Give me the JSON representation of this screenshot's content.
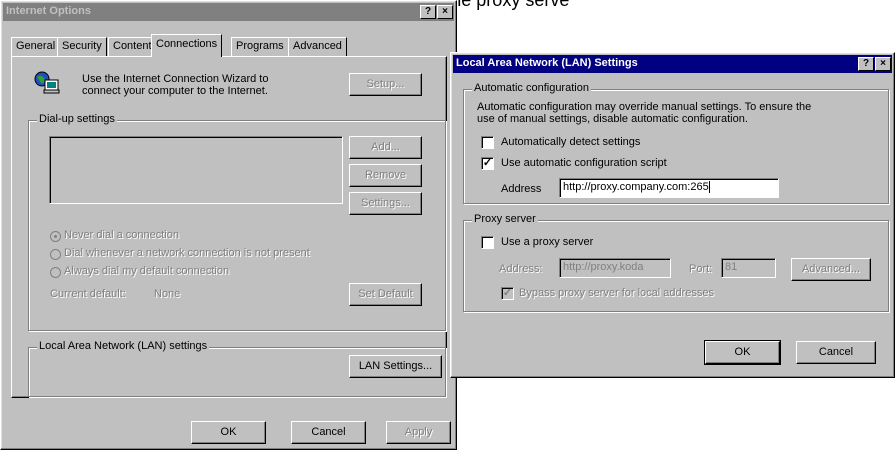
{
  "background": {
    "text": "able to an xxx Add appear in the information about the proxy serve"
  },
  "internet_options": {
    "title": "Internet Options",
    "help_button": "?",
    "close_button": "×",
    "tabs": [
      "General",
      "Security",
      "Content",
      "Connections",
      "Programs",
      "Advanced"
    ],
    "active_tab": "Connections",
    "wizard_text_line1": "Use the Internet Connection Wizard to",
    "wizard_text_line2": "connect your computer to the Internet.",
    "setup_button": "Setup...",
    "dialup_group": "Dial-up settings",
    "add_button": "Add...",
    "remove_button": "Remove",
    "settings_button": "Settings...",
    "radio_never": "Never dial a connection",
    "radio_whenever": "Dial whenever a network connection is not present",
    "radio_always": "Always dial my default connection",
    "current_default_label": "Current default:",
    "current_default_value": "None",
    "set_default_button": "Set Default",
    "lan_group": "Local Area Network (LAN) settings",
    "lan_settings_button": "LAN Settings...",
    "ok_button": "OK",
    "cancel_button": "Cancel",
    "apply_button": "Apply"
  },
  "lan_dialog": {
    "title": "Local Area Network (LAN) Settings",
    "help_button": "?",
    "close_button": "×",
    "auto_config_group": "Automatic configuration",
    "auto_config_desc_line1": "Automatic configuration may override manual settings.  To ensure the",
    "auto_config_desc_line2": "use of manual settings, disable automatic configuration.",
    "auto_detect_label": "Automatically detect settings",
    "auto_detect_checked": false,
    "use_script_label": "Use automatic configuration script",
    "use_script_checked": true,
    "check_mark": "✓",
    "address_label": "Address",
    "address_value": "http://proxy.company.com:265",
    "proxy_group": "Proxy server",
    "use_proxy_label": "Use a proxy server",
    "use_proxy_checked": false,
    "proxy_address_label": "Address:",
    "proxy_address_value": "http://proxy.koda",
    "port_label": "Port:",
    "port_value": "81",
    "advanced_button": "Advanced...",
    "bypass_label": "Bypass proxy server for local addresses",
    "bypass_checked": true,
    "ok_button": "OK",
    "cancel_button": "Cancel"
  }
}
